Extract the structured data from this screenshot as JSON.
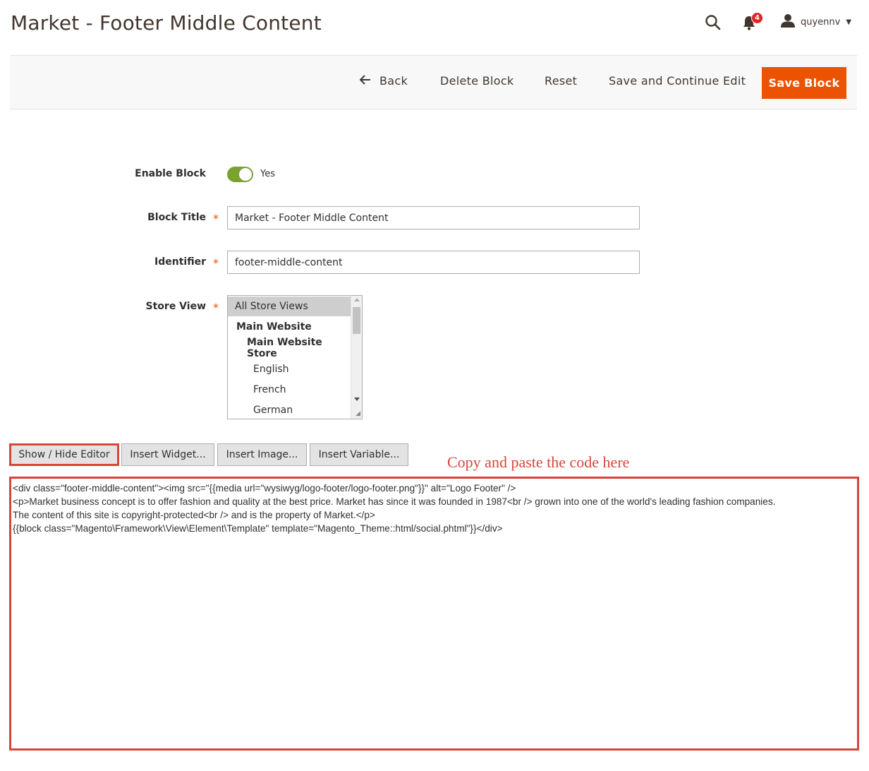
{
  "header": {
    "title": "Market - Footer Middle Content",
    "notifications_count": "4",
    "username": "quyennv"
  },
  "toolbar": {
    "back_label": "Back",
    "delete_label": "Delete Block",
    "reset_label": "Reset",
    "save_continue_label": "Save and Continue Edit",
    "save_label": "Save Block"
  },
  "form": {
    "enable_block": {
      "label": "Enable Block",
      "value_label": "Yes",
      "enabled": true
    },
    "block_title": {
      "label": "Block Title",
      "value": "Market - Footer Middle Content"
    },
    "identifier": {
      "label": "Identifier",
      "value": "footer-middle-content"
    },
    "store_view": {
      "label": "Store View",
      "options": [
        "All Store Views",
        "Main Website",
        "Main Website Store",
        "English",
        "French",
        "German"
      ],
      "selected": "All Store Views"
    }
  },
  "editor": {
    "show_hide_label": "Show / Hide Editor",
    "insert_widget_label": "Insert Widget...",
    "insert_image_label": "Insert Image...",
    "insert_variable_label": "Insert Variable...",
    "annotation": "Copy and paste the code here",
    "content": "<div class=\"footer-middle-content\"><img src=\"{{media url=\"wysiwyg/logo-footer/logo-footer.png\"}}\" alt=\"Logo Footer\" />\n<p>Market business concept is to offer fashion and quality at the best price. Market has since it was founded in 1987<br /> grown into one of the world's leading fashion companies.\nThe content of this site is copyright-protected<br /> and is the property of Market.</p>\n{{block class=\"Magento\\Framework\\View\\Element\\Template\" template=\"Magento_Theme::html/social.phtml\"}}</div>"
  },
  "colors": {
    "accent": "#eb5202",
    "toggle_on": "#79a22e",
    "highlight": "#d9443b",
    "badge": "#e22626"
  }
}
